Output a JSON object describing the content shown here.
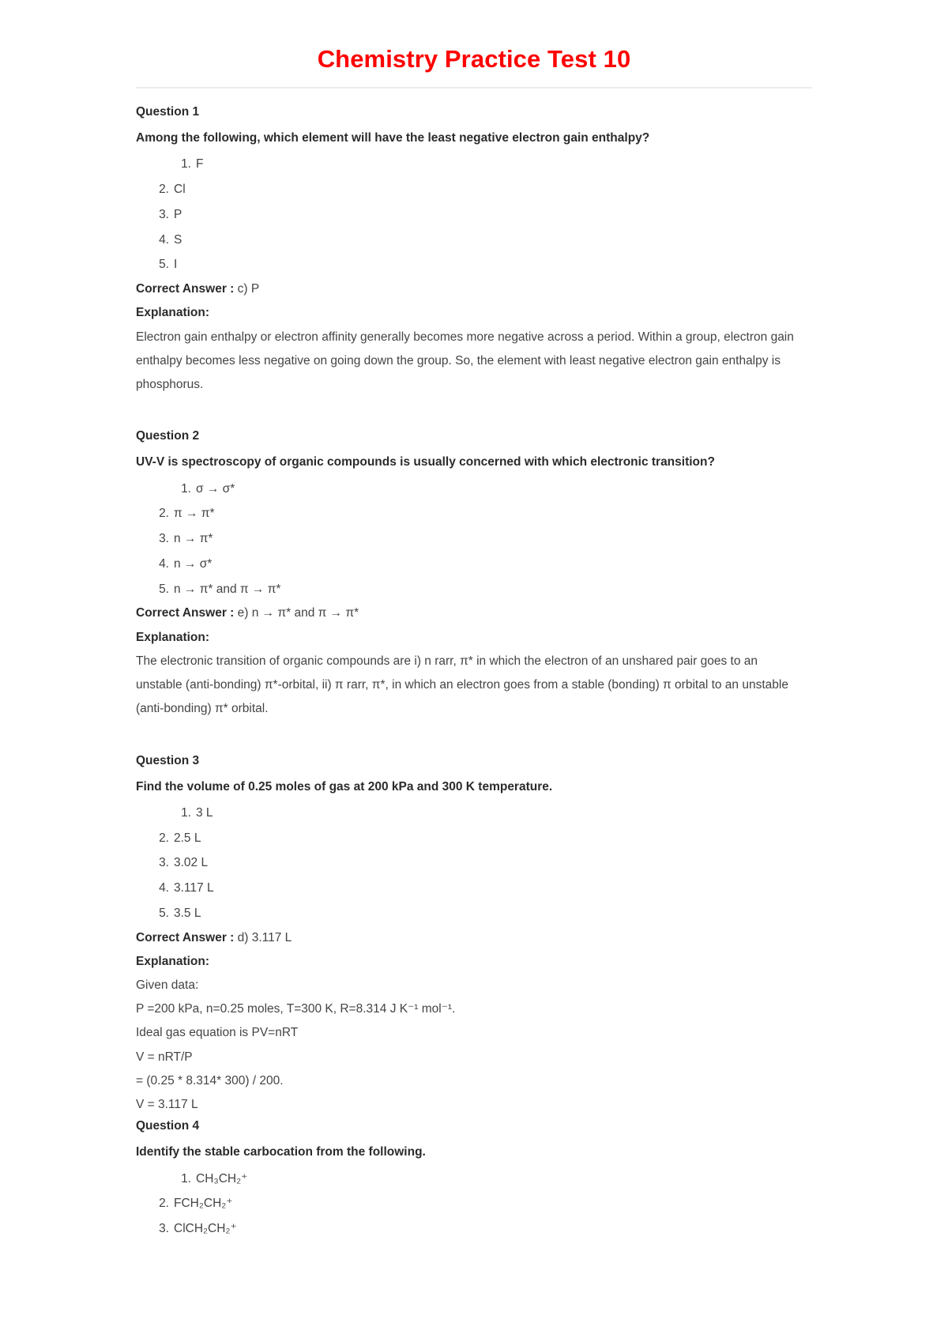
{
  "document": {
    "title": "Chemistry Practice Test 10",
    "title_color": "#ff0000"
  },
  "labels": {
    "correct_answer": "Correct Answer :",
    "explanation": "Explanation:"
  },
  "questions": [
    {
      "label": "Question 1",
      "text": "Among the following, which element will have the least negative electron gain enthalpy?",
      "options": [
        "F",
        "Cl",
        "P",
        "S",
        "I"
      ],
      "option_numbers": [
        "1.",
        "2.",
        "3.",
        "4.",
        "5."
      ],
      "answer": "c) P",
      "explanation": "Electron gain enthalpy or electron affinity generally becomes more negative across a period. Within a group, electron gain enthalpy becomes less negative on going down the group. So, the element with least negative electron gain enthalpy is phosphorus."
    },
    {
      "label": "Question 2",
      "text": "UV-V is spectroscopy of organic compounds is usually concerned with which electronic transition?",
      "options": [
        "σ → σ*",
        "π → π*",
        "n → π*",
        "n → σ*",
        "n → π* and π → π*"
      ],
      "option_numbers": [
        "1.",
        "2.",
        "3.",
        "4.",
        "5."
      ],
      "answer": "e) n → π* and π → π*",
      "explanation": "The electronic transition of organic compounds are i) n rarr, π* in which the electron of an unshared pair goes to an unstable (anti-bonding) π*-orbital, ii) π rarr, π*, in which an electron goes from a stable (bonding) π orbital to an unstable (anti-bonding) π* orbital."
    },
    {
      "label": "Question 3",
      "text": "Find the volume of 0.25 moles of gas at 200 kPa and 300 K temperature.",
      "options": [
        "3 L",
        "2.5 L",
        "3.02 L",
        "3.117 L",
        "3.5 L"
      ],
      "option_numbers": [
        "1.",
        "2.",
        "3.",
        "4.",
        "5."
      ],
      "answer": "d) 3.117 L",
      "calc_lines": [
        "Given data:",
        "P =200 kPa, n=0.25 moles, T=300 K, R=8.314 J K⁻¹ mol⁻¹.",
        "Ideal gas equation is PV=nRT",
        "V = nRT/P",
        "= (0.25 * 8.314* 300) / 200.",
        "V = 3.117 L"
      ]
    },
    {
      "label": "Question 4",
      "text": "Identify the stable carbocation from the following.",
      "options": [
        "CH₃CH₂⁺",
        "FCH₂CH₂⁺",
        "ClCH₂CH₂⁺"
      ],
      "option_numbers": [
        "1.",
        "2.",
        "3."
      ]
    }
  ]
}
